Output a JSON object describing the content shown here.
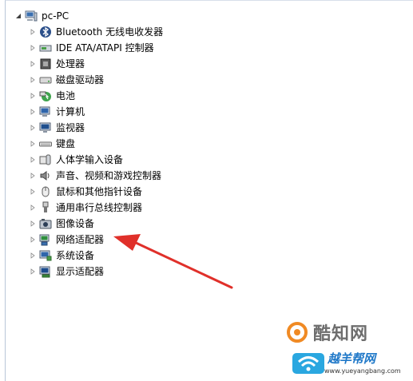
{
  "tree": {
    "root": {
      "label": "pc-PC"
    },
    "items": [
      {
        "label": "Bluetooth 无线电收发器",
        "icon": "bluetooth-icon"
      },
      {
        "label": "IDE ATA/ATAPI 控制器",
        "icon": "ide-controller-icon"
      },
      {
        "label": "处理器",
        "icon": "processor-icon"
      },
      {
        "label": "磁盘驱动器",
        "icon": "disk-drive-icon"
      },
      {
        "label": "电池",
        "icon": "battery-icon"
      },
      {
        "label": "计算机",
        "icon": "computer-icon"
      },
      {
        "label": "监视器",
        "icon": "monitor-icon"
      },
      {
        "label": "键盘",
        "icon": "keyboard-icon"
      },
      {
        "label": "人体学输入设备",
        "icon": "hid-icon"
      },
      {
        "label": "声音、视频和游戏控制器",
        "icon": "sound-icon"
      },
      {
        "label": "鼠标和其他指针设备",
        "icon": "mouse-icon"
      },
      {
        "label": "通用串行总线控制器",
        "icon": "usb-icon"
      },
      {
        "label": "图像设备",
        "icon": "camera-icon"
      },
      {
        "label": "网络适配器",
        "icon": "network-adapter-icon"
      },
      {
        "label": "系统设备",
        "icon": "system-device-icon"
      },
      {
        "label": "显示适配器",
        "icon": "display-adapter-icon"
      }
    ]
  },
  "annotation": {
    "arrow_color": "#e0302a"
  },
  "watermark": {
    "text1": "酷知网",
    "text2": "越羊帮网",
    "url": "www.yueyangbang.com"
  }
}
